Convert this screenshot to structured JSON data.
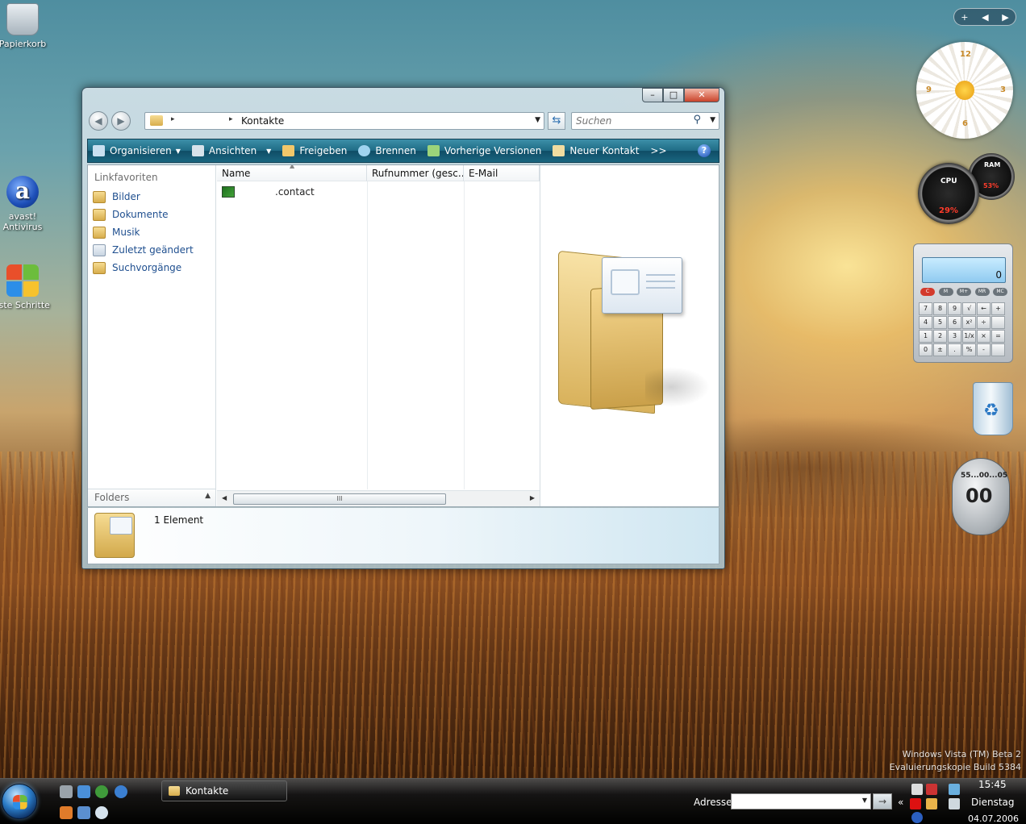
{
  "desktop": {
    "icons": [
      {
        "name": "Papierkorb"
      },
      {
        "name": "avast!\nAntivirus",
        "line1": "avast!",
        "line2": "Antivirus"
      },
      {
        "name": "rste Schritte"
      }
    ],
    "watermark": {
      "line1": "Windows Vista (TM) Beta 2",
      "line2": "Evaluierungskopie Build 5384"
    }
  },
  "window": {
    "caption_buttons": {
      "minimize": "–",
      "maximize": "□",
      "close": "✕"
    },
    "nav": {
      "back": "◀",
      "forward": "▶"
    },
    "address": {
      "crumb": "Kontakte",
      "sep": "▸"
    },
    "search": {
      "placeholder": "Suchen"
    },
    "toolbar": {
      "items": [
        {
          "label": "Organisieren",
          "icon": "organize-icon",
          "color": "#c9dff0"
        },
        {
          "label": "Ansichten",
          "icon": "views-icon",
          "color": "#d7e2ea"
        },
        {
          "label": "Freigeben",
          "icon": "share-icon",
          "color": "#f2c76a"
        },
        {
          "label": "Brennen",
          "icon": "burn-icon",
          "color": "#9fd3ef"
        },
        {
          "label": "Vorherige Versionen",
          "icon": "previous-versions-icon",
          "color": "#9bd37a"
        },
        {
          "label": "Neuer Kontakt",
          "icon": "new-contact-icon",
          "color": "#f0dca0"
        }
      ],
      "more": ">>",
      "help": "?"
    },
    "nav_pane": {
      "header": "Linkfavoriten",
      "items": [
        "Bilder",
        "Dokumente",
        "Musik",
        "Zuletzt geändert",
        "Suchvorgänge"
      ],
      "folders": "Folders"
    },
    "list": {
      "columns": [
        "Name",
        "Rufnummer (gesc...",
        "E-Mail"
      ],
      "rows": [
        {
          "name": ".contact"
        }
      ],
      "scroll_grip": "III"
    },
    "details": {
      "count": "1 Element"
    }
  },
  "gadgets": {
    "sidebar_controls": {
      "add": "+",
      "prev": "◀",
      "next": "▶"
    },
    "clock": {
      "n12": "12",
      "n3": "3",
      "n6": "6",
      "n9": "9"
    },
    "cpu": {
      "label": "CPU",
      "value": "29%"
    },
    "ram": {
      "label": "RAM",
      "value": "53%"
    },
    "calculator": {
      "display": "0",
      "mem_keys": [
        "C",
        "M",
        "M+",
        "MR",
        "MC"
      ],
      "keys": [
        "7",
        "8",
        "9",
        "√",
        "←",
        "+",
        "4",
        "5",
        "6",
        "x²",
        "÷",
        "",
        "1",
        "2",
        "3",
        "1/x",
        "×",
        "=",
        "0",
        "±",
        ".",
        "%",
        "-",
        ""
      ]
    },
    "timer": {
      "top": "55...00...05",
      "value": "00"
    }
  },
  "taskbar": {
    "task_label": "Kontakte",
    "address_label": "Adresse",
    "address_go": "→",
    "tray_arrow": "«",
    "time": "15:45",
    "day": "Dienstag",
    "date": "04.07.2006"
  }
}
